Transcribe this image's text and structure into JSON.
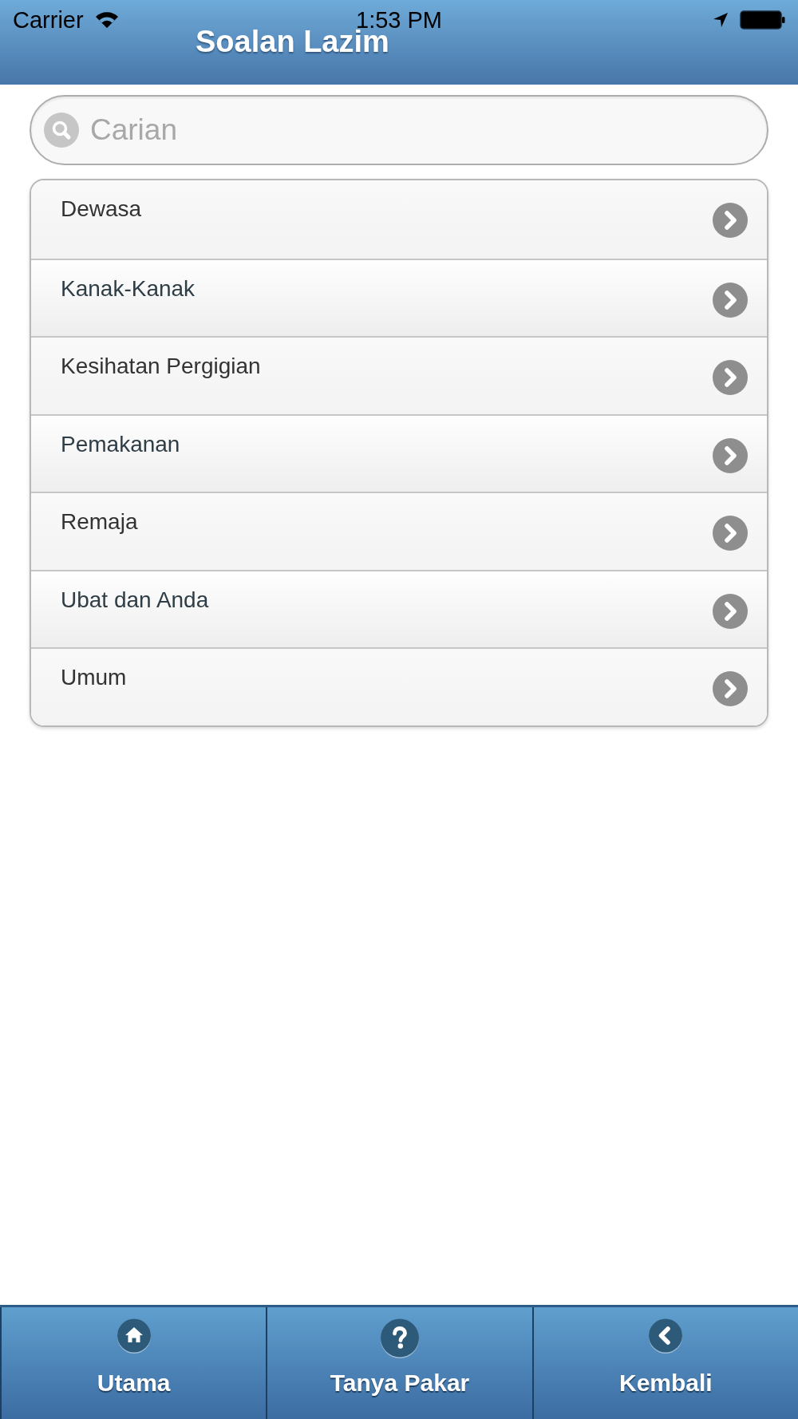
{
  "status_bar": {
    "carrier": "Carrier",
    "time": "1:53 PM"
  },
  "header": {
    "title": "Soalan Lazim"
  },
  "search": {
    "placeholder": "Carian"
  },
  "categories": [
    {
      "label": "Dewasa"
    },
    {
      "label": "Kanak-Kanak"
    },
    {
      "label": "Kesihatan Pergigian"
    },
    {
      "label": "Pemakanan"
    },
    {
      "label": "Remaja"
    },
    {
      "label": "Ubat dan Anda"
    },
    {
      "label": "Umum"
    }
  ],
  "nav_bar": [
    {
      "label": "Utama",
      "kind": "home"
    },
    {
      "label": "Tanya Pakar",
      "kind": "help"
    },
    {
      "label": "Kembali",
      "kind": "back"
    }
  ]
}
